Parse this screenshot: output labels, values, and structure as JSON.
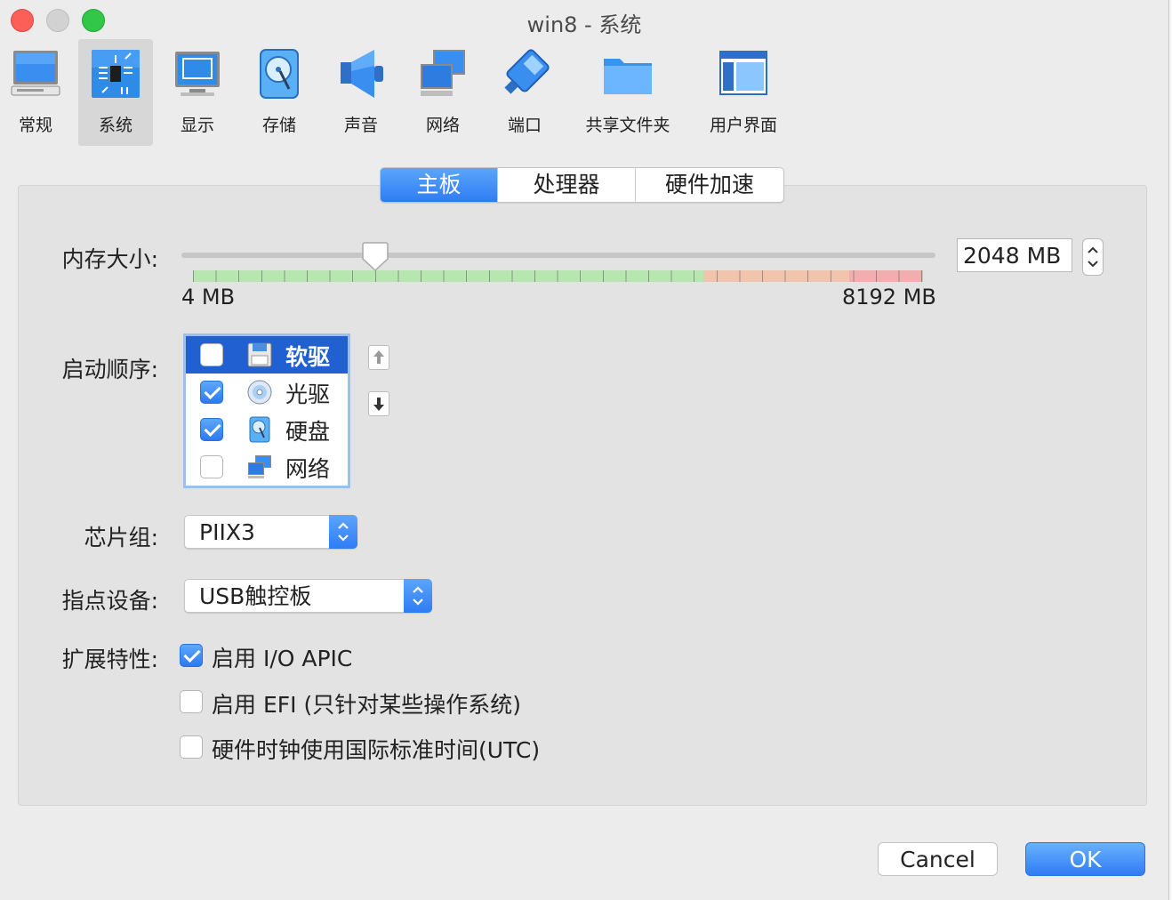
{
  "window": {
    "title": "win8 - 系统"
  },
  "toolbar": {
    "items": [
      {
        "label": "常规",
        "icon": "monitor-general-icon"
      },
      {
        "label": "系统",
        "icon": "chip-icon",
        "selected": true
      },
      {
        "label": "显示",
        "icon": "display-icon"
      },
      {
        "label": "存储",
        "icon": "harddisk-icon"
      },
      {
        "label": "声音",
        "icon": "speaker-icon"
      },
      {
        "label": "网络",
        "icon": "network-icon"
      },
      {
        "label": "端口",
        "icon": "serial-port-icon"
      },
      {
        "label": "共享文件夹",
        "icon": "folder-icon"
      },
      {
        "label": "用户界面",
        "icon": "window-ui-icon"
      }
    ]
  },
  "tabs": [
    {
      "label": "主板",
      "active": true
    },
    {
      "label": "处理器",
      "active": false
    },
    {
      "label": "硬件加速",
      "active": false
    }
  ],
  "memory": {
    "label": "内存大小:",
    "value": "2048 MB",
    "min_label": "4 MB",
    "max_label": "8192 MB",
    "value_mb": 2048,
    "min_mb": 4,
    "max_mb": 8192
  },
  "boot": {
    "label": "启动顺序:",
    "items": [
      {
        "label": "软驱",
        "checked": false,
        "icon": "floppy-icon",
        "selected": true
      },
      {
        "label": "光驱",
        "checked": true,
        "icon": "optical-disc-icon",
        "selected": false
      },
      {
        "label": "硬盘",
        "checked": true,
        "icon": "harddisk-icon",
        "selected": false
      },
      {
        "label": "网络",
        "checked": false,
        "icon": "network-icon",
        "selected": false
      }
    ]
  },
  "chipset": {
    "label": "芯片组:",
    "value": "PIIX3"
  },
  "pointing": {
    "label": "指点设备:",
    "value": "USB触控板"
  },
  "features": {
    "label": "扩展特性:",
    "items": [
      {
        "label": "启用 I/O APIC",
        "checked": true
      },
      {
        "label": "启用 EFI (只针对某些操作系统)",
        "checked": false
      },
      {
        "label": "硬件时钟使用国际标准时间(UTC)",
        "checked": false
      }
    ]
  },
  "buttons": {
    "cancel": "Cancel",
    "ok": "OK"
  },
  "colors": {
    "accent": "#2f7cf5",
    "selection": "#2060d0"
  }
}
